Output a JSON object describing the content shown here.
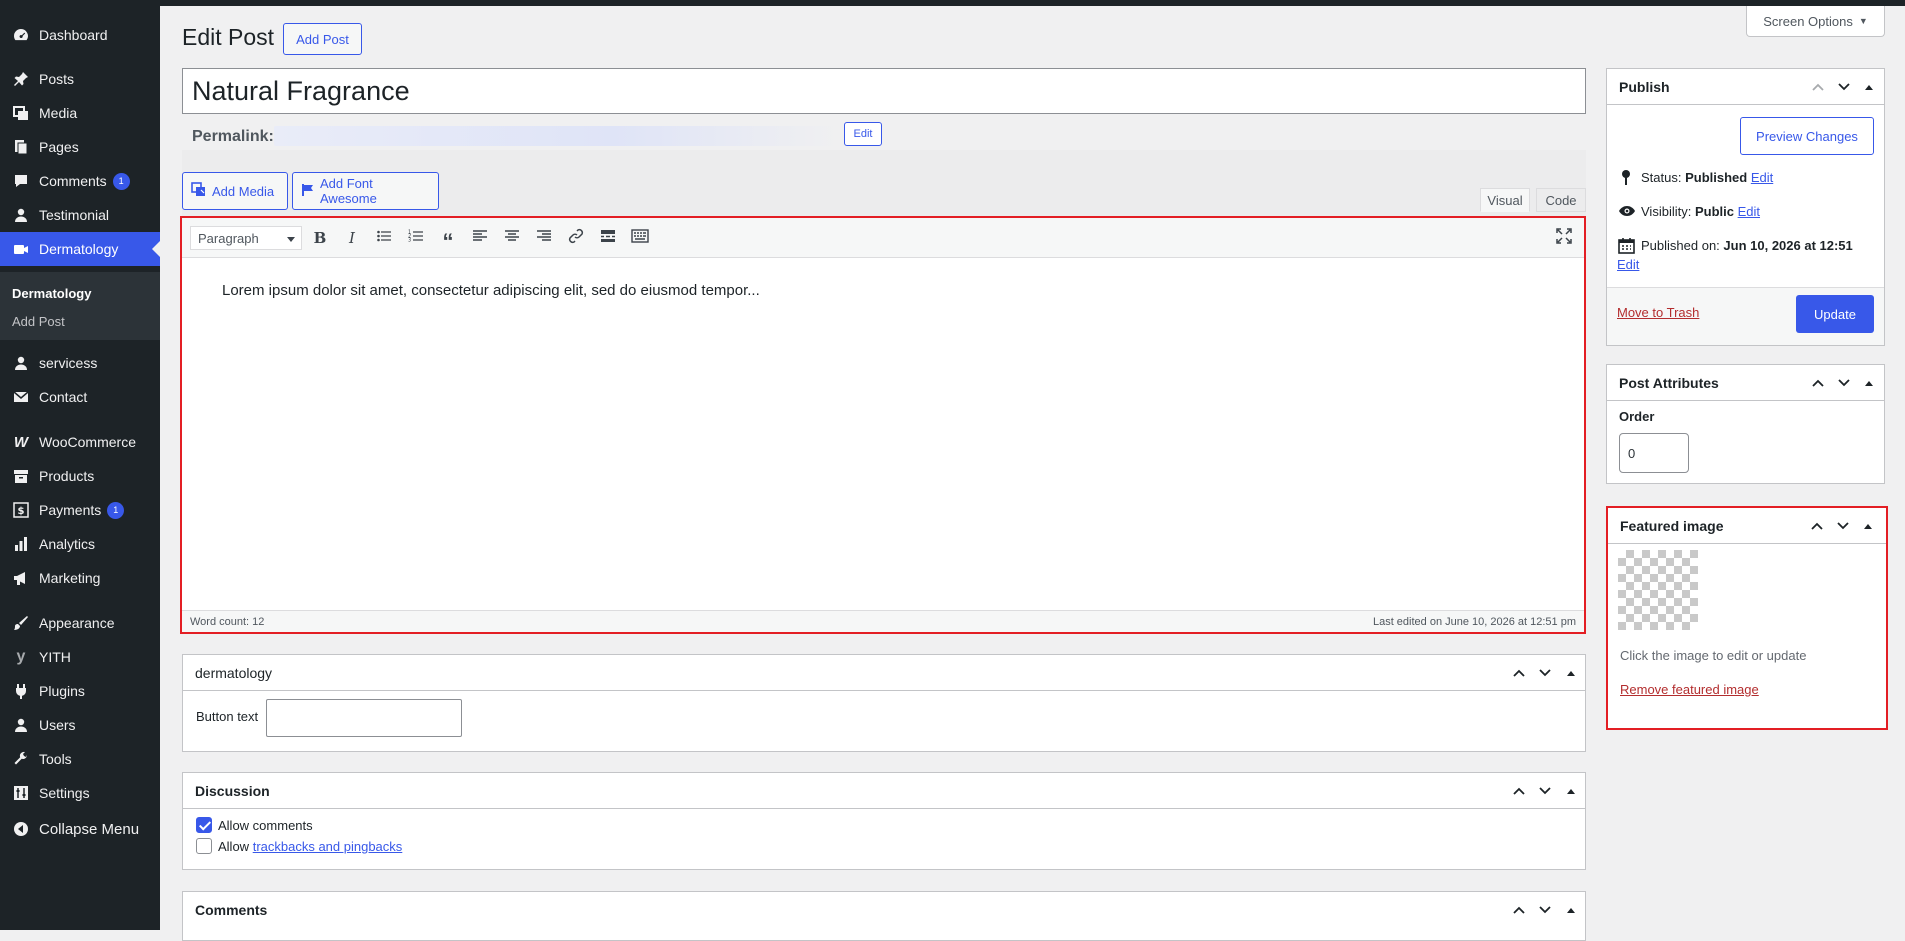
{
  "sidebar": {
    "items": [
      {
        "label": "Dashboard",
        "icon": "dashboard-icon"
      },
      {
        "label": "Posts",
        "icon": "pin-icon"
      },
      {
        "label": "Media",
        "icon": "media-icon"
      },
      {
        "label": "Pages",
        "icon": "pages-icon"
      },
      {
        "label": "Comments",
        "icon": "comment-icon",
        "badge": "1"
      },
      {
        "label": "Testimonial",
        "icon": "user-icon"
      },
      {
        "label": "Dermatology",
        "icon": "video-icon"
      },
      {
        "label": "servicess",
        "icon": "user-icon"
      },
      {
        "label": "Contact",
        "icon": "mail-icon"
      },
      {
        "label": "WooCommerce",
        "icon": "woo-icon"
      },
      {
        "label": "Products",
        "icon": "archive-icon"
      },
      {
        "label": "Payments",
        "icon": "dollar-icon",
        "badge": "1"
      },
      {
        "label": "Analytics",
        "icon": "chart-bar-icon"
      },
      {
        "label": "Marketing",
        "icon": "megaphone-icon"
      },
      {
        "label": "Appearance",
        "icon": "brush-icon"
      },
      {
        "label": "YITH",
        "icon": "yith-icon"
      },
      {
        "label": "Plugins",
        "icon": "plugin-icon"
      },
      {
        "label": "Users",
        "icon": "user-icon"
      },
      {
        "label": "Tools",
        "icon": "wrench-icon"
      },
      {
        "label": "Settings",
        "icon": "settings-icon"
      },
      {
        "label": "Collapse Menu",
        "icon": "collapse-icon"
      }
    ],
    "submenu": [
      {
        "label": "Dermatology"
      },
      {
        "label": "Add Post"
      }
    ]
  },
  "header": {
    "title": "Edit Post",
    "add_post_label": "Add Post",
    "screen_options_label": "Screen Options"
  },
  "post": {
    "title": "Natural Fragrance",
    "permalink_label": "Permalink:",
    "permalink_edit_label": "Edit"
  },
  "editor": {
    "add_media_label": "Add Media",
    "add_font_awesome_label": "Add Font Awesome",
    "tab_visual": "Visual",
    "tab_code": "Code",
    "format_select": "Paragraph",
    "content": "Lorem ipsum dolor sit amet, consectetur adipiscing elit, sed do eiusmod tempor...",
    "word_count": "Word count: 12",
    "last_edited": "Last edited on June 10, 2026 at 12:51 pm"
  },
  "dermatology_box": {
    "title": "dermatology",
    "button_text_label": "Button text",
    "button_text_value": ""
  },
  "discussion_box": {
    "title": "Discussion",
    "allow_comments_label": "Allow comments",
    "allow_comments_checked": true,
    "allow_prefix": "Allow",
    "trackbacks_link": "trackbacks and pingbacks",
    "trackbacks_checked": false
  },
  "comments_box": {
    "title": "Comments"
  },
  "publish_box": {
    "title": "Publish",
    "preview_label": "Preview Changes",
    "status_label": "Status:",
    "status_value": "Published",
    "visibility_label": "Visibility:",
    "visibility_value": "Public",
    "published_on_label": "Published on:",
    "published_on_value": "Jun 10, 2026 at 12:51",
    "edit_label": "Edit",
    "trash_label": "Move to Trash",
    "update_label": "Update"
  },
  "attributes_box": {
    "title": "Post Attributes",
    "order_label": "Order",
    "order_value": "0"
  },
  "featured_box": {
    "title": "Featured image",
    "hint": "Click the image to edit or update",
    "remove_label": "Remove featured image"
  },
  "colors": {
    "accent": "#3858e9",
    "sidebar_bg": "#1d2327",
    "highlight_outline": "#e31e24",
    "trash": "#b32d2e"
  }
}
